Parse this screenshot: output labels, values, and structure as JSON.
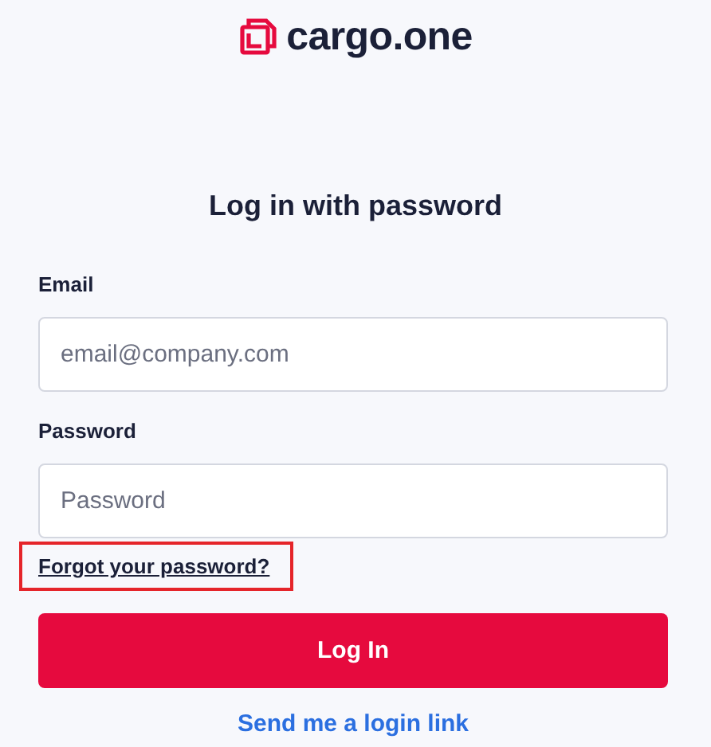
{
  "logo": {
    "text": "cargo.one"
  },
  "title": "Log in with password",
  "fields": [
    {
      "label": "Email",
      "placeholder": "email@company.com"
    },
    {
      "label": "Password",
      "placeholder": "Password"
    }
  ],
  "forgot_link": {
    "text": "Forgot your password?",
    "highlighted": true
  },
  "login_button": "Log In",
  "login_link": "Send me a login link"
}
